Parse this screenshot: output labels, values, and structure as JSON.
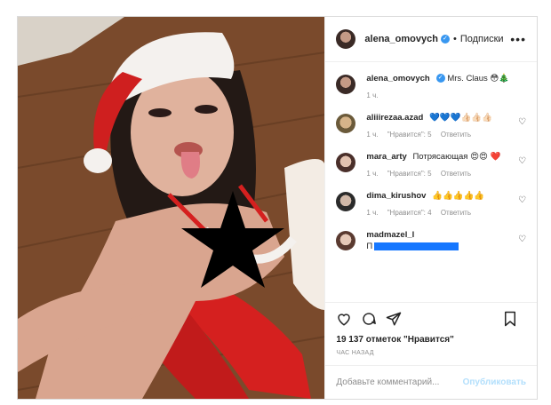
{
  "header": {
    "username": "alena_omovych",
    "separator": "•",
    "follow_label": "Подписки",
    "more": "•••"
  },
  "caption": {
    "username": "alena_omovych",
    "text": "Mrs. Claus 😳🎄",
    "time": "1 ч."
  },
  "comments": [
    {
      "username": "aliiirezaa.azad",
      "text": "💙💙💙👍🏻👍🏻👍🏻",
      "time": "1 ч.",
      "likes": "\"Нравится\": 5",
      "reply": "Ответить"
    },
    {
      "username": "mara_arty",
      "text": "Потрясающая 😍😍 ❤️",
      "time": "1 ч.",
      "likes": "\"Нравится\": 5",
      "reply": "Ответить"
    },
    {
      "username": "dima_kirushov",
      "text": "👍👍👍👍👍",
      "time": "1 ч.",
      "likes": "\"Нравится\": 4",
      "reply": "Ответить"
    },
    {
      "username": "madmazel_l",
      "text": "П",
      "time": "",
      "likes": "",
      "reply": ""
    }
  ],
  "actions": {
    "likes_count": "19 137 отметок \"Нравится\"",
    "posted": "ЧАС НАЗАД"
  },
  "add_comment": {
    "placeholder": "Добавьте комментарий...",
    "publish": "Опубликовать"
  },
  "colors": {
    "accent": "#3897f0",
    "publish_disabled": "#b2dffc",
    "border": "#dbdbdb"
  },
  "icons": [
    "heart-icon",
    "comment-icon",
    "share-icon",
    "bookmark-icon",
    "verified-icon",
    "more-icon"
  ]
}
